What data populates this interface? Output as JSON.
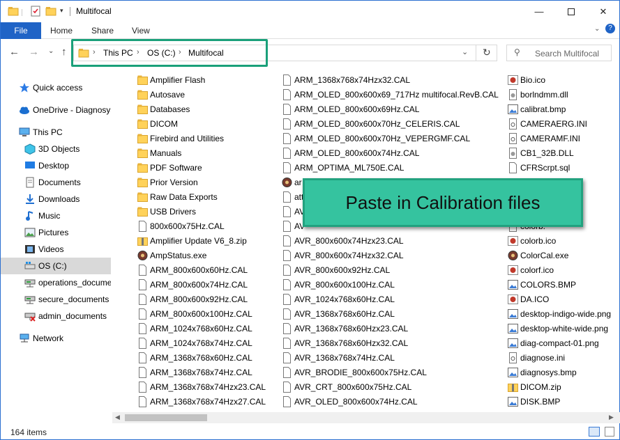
{
  "window": {
    "title": "Multifocal"
  },
  "ribbon": {
    "tabs": [
      "File",
      "Home",
      "Share",
      "View"
    ]
  },
  "address": {
    "crumbs": [
      "This PC",
      "OS (C:)",
      "Multifocal"
    ]
  },
  "search": {
    "placeholder": "Search Multifocal"
  },
  "nav": {
    "items": [
      {
        "label": "Quick access",
        "icon": "star-icon"
      },
      {
        "label": "OneDrive - Diagnosys",
        "icon": "cloud-icon"
      },
      {
        "label": "This PC",
        "icon": "computer-icon"
      },
      {
        "label": "3D Objects",
        "icon": "cube-icon"
      },
      {
        "label": "Desktop",
        "icon": "desktop-icon"
      },
      {
        "label": "Documents",
        "icon": "documents-icon"
      },
      {
        "label": "Downloads",
        "icon": "download-icon"
      },
      {
        "label": "Music",
        "icon": "music-icon"
      },
      {
        "label": "Pictures",
        "icon": "pictures-icon"
      },
      {
        "label": "Videos",
        "icon": "videos-icon"
      },
      {
        "label": "OS (C:)",
        "icon": "drive-icon"
      },
      {
        "label": "operations_documents",
        "icon": "network-drive-icon"
      },
      {
        "label": "secure_documents",
        "icon": "network-drive-icon"
      },
      {
        "label": "admin_documents",
        "icon": "network-drive-disconnected-icon"
      },
      {
        "label": "Network",
        "icon": "network-icon"
      }
    ]
  },
  "files": {
    "col1": [
      {
        "name": "Amplifier Flash",
        "type": "folder"
      },
      {
        "name": "Autosave",
        "type": "folder"
      },
      {
        "name": "Databases",
        "type": "folder"
      },
      {
        "name": "DICOM",
        "type": "folder"
      },
      {
        "name": "Firebird and Utilities",
        "type": "folder"
      },
      {
        "name": "Manuals",
        "type": "folder"
      },
      {
        "name": "PDF Software",
        "type": "folder"
      },
      {
        "name": "Prior Version",
        "type": "folder"
      },
      {
        "name": "Raw Data Exports",
        "type": "folder"
      },
      {
        "name": "USB Drivers",
        "type": "folder"
      },
      {
        "name": "800x600x75Hz.CAL",
        "type": "file"
      },
      {
        "name": "Amplifier Update V6_8.zip",
        "type": "zip"
      },
      {
        "name": "AmpStatus.exe",
        "type": "exe"
      },
      {
        "name": "ARM_800x600x60Hz.CAL",
        "type": "file"
      },
      {
        "name": "ARM_800x600x74Hz.CAL",
        "type": "file"
      },
      {
        "name": "ARM_800x600x92Hz.CAL",
        "type": "file"
      },
      {
        "name": "ARM_800x600x100Hz.CAL",
        "type": "file"
      },
      {
        "name": "ARM_1024x768x60Hz.CAL",
        "type": "file"
      },
      {
        "name": "ARM_1024x768x74Hz.CAL",
        "type": "file"
      },
      {
        "name": "ARM_1368x768x60Hz.CAL",
        "type": "file"
      },
      {
        "name": "ARM_1368x768x74Hz.CAL",
        "type": "file"
      },
      {
        "name": "ARM_1368x768x74Hzx23.CAL",
        "type": "file"
      },
      {
        "name": "ARM_1368x768x74Hzx27.CAL",
        "type": "file"
      }
    ],
    "col2": [
      {
        "name": "ARM_1368x768x74Hzx32.CAL",
        "type": "file"
      },
      {
        "name": "ARM_OLED_800x600x69_717Hz multifocal.RevB.CAL",
        "type": "file"
      },
      {
        "name": "ARM_OLED_800x600x69Hz.CAL",
        "type": "file"
      },
      {
        "name": "ARM_OLED_800x600x70Hz_CELERIS.CAL",
        "type": "file"
      },
      {
        "name": "ARM_OLED_800x600x70Hz_VEPERGMF.CAL",
        "type": "file"
      },
      {
        "name": "ARM_OLED_800x600x74Hz.CAL",
        "type": "file"
      },
      {
        "name": "ARM_OPTIMA_ML750E.CAL",
        "type": "file"
      },
      {
        "name": "ar",
        "type": "exe"
      },
      {
        "name": "att",
        "type": "file"
      },
      {
        "name": "AV",
        "type": "file"
      },
      {
        "name": "AV",
        "type": "file"
      },
      {
        "name": "AVR_800x600x74Hzx23.CAL",
        "type": "file"
      },
      {
        "name": "AVR_800x600x74Hzx32.CAL",
        "type": "file"
      },
      {
        "name": "AVR_800x600x92Hz.CAL",
        "type": "file"
      },
      {
        "name": "AVR_800x600x100Hz.CAL",
        "type": "file"
      },
      {
        "name": "AVR_1024x768x60Hz.CAL",
        "type": "file"
      },
      {
        "name": "AVR_1368x768x60Hz.CAL",
        "type": "file"
      },
      {
        "name": "AVR_1368x768x60Hzx23.CAL",
        "type": "file"
      },
      {
        "name": "AVR_1368x768x60Hzx32.CAL",
        "type": "file"
      },
      {
        "name": "AVR_1368x768x74Hz.CAL",
        "type": "file"
      },
      {
        "name": "AVR_BRODIE_800x600x75Hz.CAL",
        "type": "file"
      },
      {
        "name": "AVR_CRT_800x600x75Hz.CAL",
        "type": "file"
      },
      {
        "name": "AVR_OLED_800x600x74Hz.CAL",
        "type": "file"
      }
    ],
    "col3": [
      {
        "name": "Bio.ico",
        "type": "ico"
      },
      {
        "name": "borlndmm.dll",
        "type": "dll"
      },
      {
        "name": "calibrat.bmp",
        "type": "img"
      },
      {
        "name": "CAMERAERG.INI",
        "type": "ini"
      },
      {
        "name": "CAMERAMF.INI",
        "type": "ini"
      },
      {
        "name": "CB1_32B.DLL",
        "type": "dll"
      },
      {
        "name": "CFRScrpt.sql",
        "type": "file"
      },
      {
        "name": "",
        "type": "hidden"
      },
      {
        "name": "",
        "type": "hidden"
      },
      {
        "name": "",
        "type": "hidden"
      },
      {
        "name": "colorb.",
        "type": "file"
      },
      {
        "name": "colorb.ico",
        "type": "ico"
      },
      {
        "name": "ColorCal.exe",
        "type": "exe"
      },
      {
        "name": "colorf.ico",
        "type": "ico"
      },
      {
        "name": "COLORS.BMP",
        "type": "img"
      },
      {
        "name": "DA.ICO",
        "type": "ico"
      },
      {
        "name": "desktop-indigo-wide.png",
        "type": "img"
      },
      {
        "name": "desktop-white-wide.png",
        "type": "img"
      },
      {
        "name": "diag-compact-01.png",
        "type": "img"
      },
      {
        "name": "diagnose.ini",
        "type": "ini"
      },
      {
        "name": "diagnosys.bmp",
        "type": "img"
      },
      {
        "name": "DICOM.zip",
        "type": "zip"
      },
      {
        "name": "DISK.BMP",
        "type": "img"
      }
    ]
  },
  "status": {
    "count": "164 items"
  },
  "callout": {
    "text": "Paste in Calibration files"
  },
  "colors": {
    "accent": "#1f63c6",
    "callout": "#35c39f",
    "highlight": "#1aa07a"
  }
}
